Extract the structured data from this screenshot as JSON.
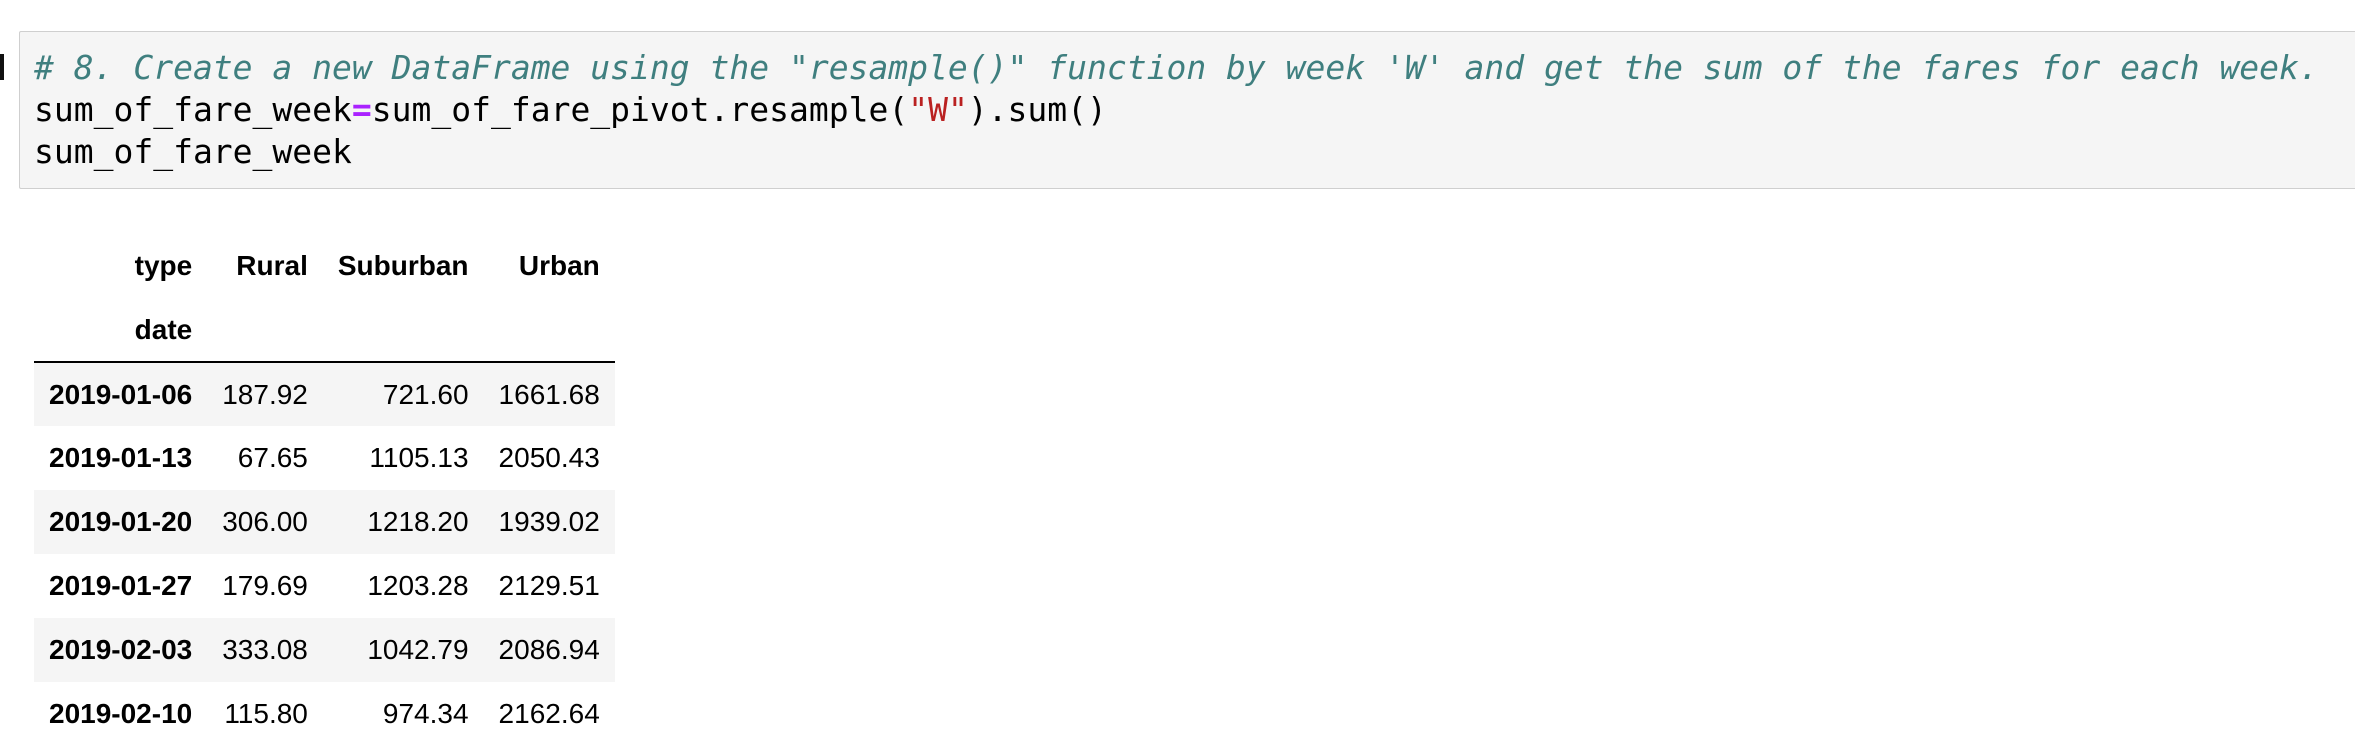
{
  "cell": {
    "comment": "# 8. Create a new DataFrame using the \"resample()\" function by week 'W' and get the sum of the fares for each week.",
    "code_var": "sum_of_fare_week",
    "code_op": "=",
    "code_expr_prefix": "sum_of_fare_pivot.resample(",
    "code_string": "\"W\"",
    "code_expr_suffix": ").sum()",
    "code_line3": "sum_of_fare_week"
  },
  "dataframe": {
    "columns_name": "type",
    "columns": [
      "Rural",
      "Suburban",
      "Urban"
    ],
    "index_name": "date",
    "rows": [
      {
        "date": "2019-01-06",
        "values": [
          "187.92",
          "721.60",
          "1661.68"
        ]
      },
      {
        "date": "2019-01-13",
        "values": [
          "67.65",
          "1105.13",
          "2050.43"
        ]
      },
      {
        "date": "2019-01-20",
        "values": [
          "306.00",
          "1218.20",
          "1939.02"
        ]
      },
      {
        "date": "2019-01-27",
        "values": [
          "179.69",
          "1203.28",
          "2129.51"
        ]
      },
      {
        "date": "2019-02-03",
        "values": [
          "333.08",
          "1042.79",
          "2086.94"
        ]
      },
      {
        "date": "2019-02-10",
        "values": [
          "115.80",
          "974.34",
          "2162.64"
        ]
      }
    ]
  }
}
